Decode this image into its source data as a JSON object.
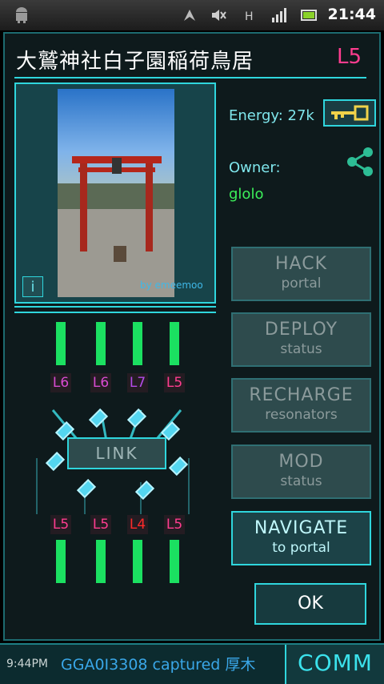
{
  "status": {
    "time": "21:44"
  },
  "portal": {
    "title": "大鷲神社白子園稲荷鳥居",
    "level": "L5",
    "photo_credit": "by emeemoo",
    "energy_label": "Energy:",
    "energy_value": "27k",
    "owner_label": "Owner:",
    "owner_name": "glolo"
  },
  "actions": {
    "hack": {
      "l1": "HACK",
      "l2": "portal"
    },
    "deploy": {
      "l1": "DEPLOY",
      "l2": "status"
    },
    "recharge": {
      "l1": "RECHARGE",
      "l2": "resonators"
    },
    "mod": {
      "l1": "MOD",
      "l2": "status"
    },
    "navigate": {
      "l1": "NAVIGATE",
      "l2": "to portal"
    },
    "ok": "OK",
    "link": "LINK"
  },
  "resonators": {
    "top": [
      "L6",
      "L6",
      "L7",
      "L5"
    ],
    "bottom": [
      "L5",
      "L5",
      "L4",
      "L5"
    ],
    "colors": {
      "L6": "#d84bd1",
      "L7": "#b34be8",
      "L5": "#ff3d8f",
      "L4": "#ff2a2a"
    }
  },
  "comm": {
    "time": "9:44PM",
    "message": "GGA0I3308 captured 厚木",
    "button": "COMM"
  },
  "icons": [
    "android-icon",
    "gps-icon",
    "mute-icon",
    "data-icon",
    "signal-icon",
    "battery-icon",
    "key-icon",
    "share-icon",
    "info-icon"
  ]
}
